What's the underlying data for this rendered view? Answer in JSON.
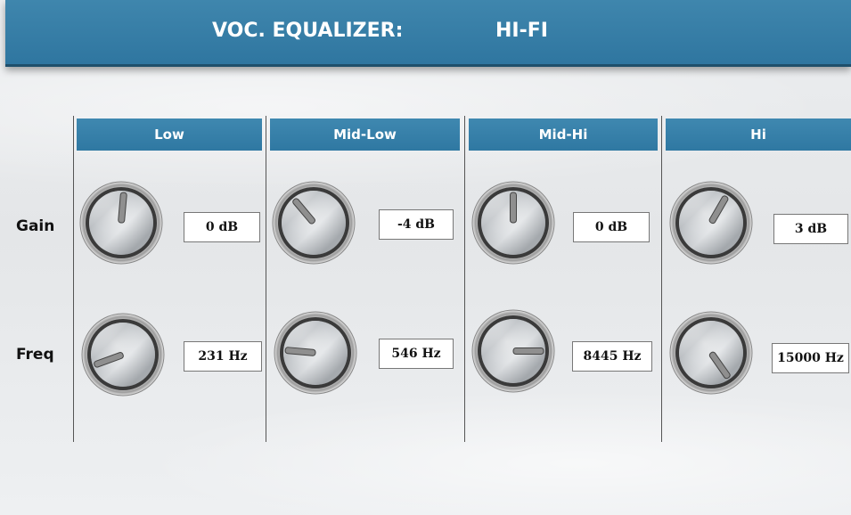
{
  "title": {
    "label": "VOC. EQUALIZER:",
    "preset": "HI-FI"
  },
  "rows": {
    "gain": "Gain",
    "freq": "Freq"
  },
  "bands": [
    {
      "name": "Low",
      "gain": "0 dB",
      "freq": "231 Hz"
    },
    {
      "name": "Mid-Low",
      "gain": "-4 dB",
      "freq": "546 Hz"
    },
    {
      "name": "Mid-Hi",
      "gain": "0 dB",
      "freq": "8445 Hz"
    },
    {
      "name": "Hi",
      "gain": "3 dB",
      "freq": "15000 Hz"
    }
  ],
  "colors": {
    "header_blue": "#3583ad",
    "knob_pointer": "#9a9a9a"
  },
  "icons": {
    "knob": "rotary-knob-icon"
  }
}
